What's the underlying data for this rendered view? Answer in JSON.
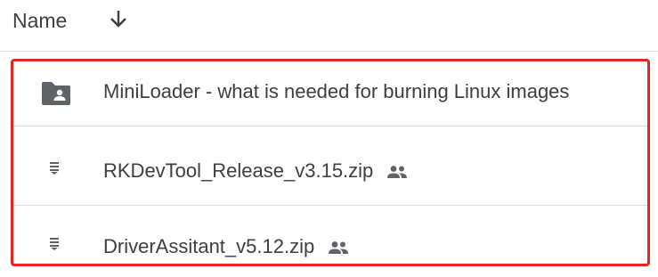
{
  "header": {
    "name_label": "Name",
    "sort_icon": "arrow-down-icon"
  },
  "files": [
    {
      "name": "MiniLoader - what is needed for burning Linux images",
      "type_icon": "shared-folder-icon",
      "shared": false
    },
    {
      "name": "RKDevTool_Release_v3.15.zip",
      "type_icon": "zip-file-icon",
      "shared": true
    },
    {
      "name": "DriverAssitant_v5.12.zip",
      "type_icon": "zip-file-icon",
      "shared": true
    }
  ],
  "colors": {
    "highlight": "#e0281f",
    "text": "#3c4043",
    "icon": "#5f6368",
    "divider": "#dadce0"
  }
}
